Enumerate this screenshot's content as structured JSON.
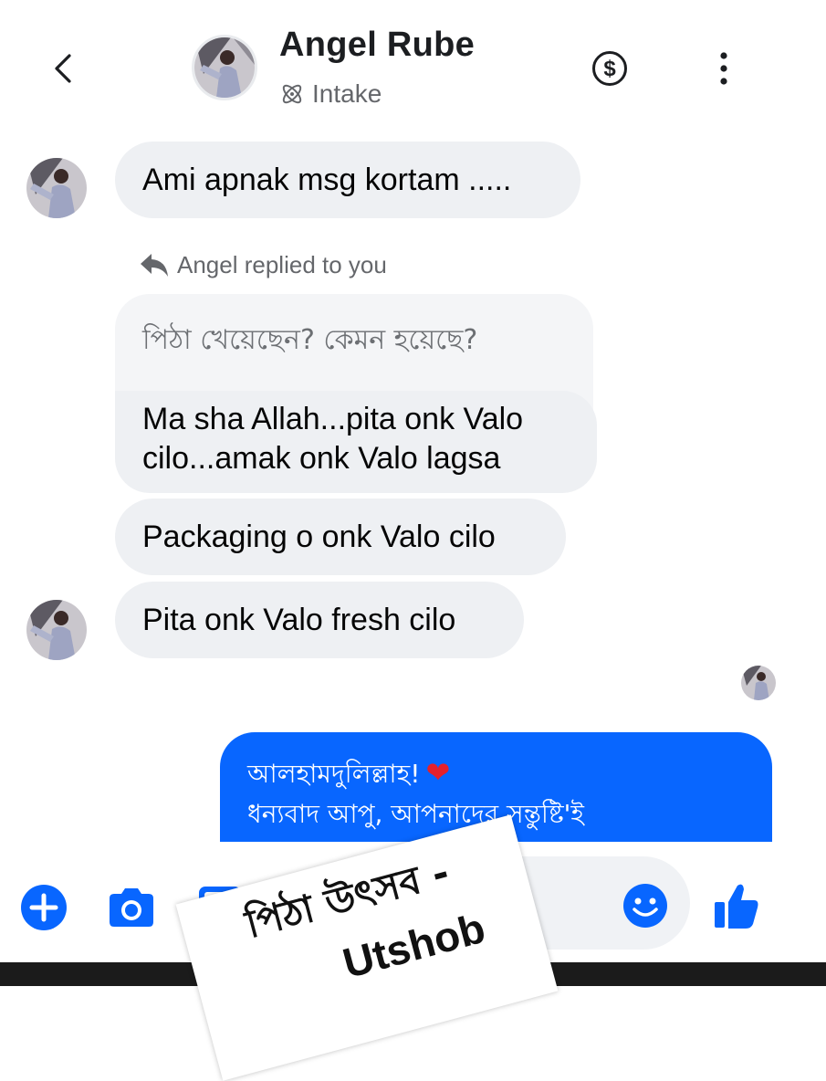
{
  "header": {
    "back_icon": "chevron-left-icon",
    "contact_name": "Angel Rube",
    "subtitle": "Intake",
    "subtitle_icon": "atom-icon",
    "payment_icon": "dollar-circle-icon",
    "menu_icon": "more-vertical-icon"
  },
  "messages": [
    {
      "sender": "Angel Rube",
      "text": "Ami apnak msg kortam ....."
    },
    {
      "reply_label": "Angel replied to you",
      "quoted": "পিঠা খেয়েছেন? কেমন হয়েছে?",
      "text": "Ma sha Allah...pita onk Valo cilo...amak onk Valo lagsa"
    },
    {
      "text": "Packaging o onk Valo cilo"
    },
    {
      "text": "Pita onk Valo fresh cilo"
    }
  ],
  "outgoing": {
    "line1": "আলহামদুলিল্লাহ!",
    "heart": "❤",
    "line2": "ধন্যবাদ আপু, আপনাদের সন্তুষ্টি'ই"
  },
  "composer": {
    "icons": [
      "plus-icon",
      "camera-icon",
      "image-icon",
      "microphone-icon",
      "emoji-icon",
      "thumbs-up-icon"
    ]
  },
  "overlay": {
    "line1": "পিঠা উৎসব -",
    "line2": "Utshob"
  },
  "colors": {
    "accent": "#0866ff",
    "incoming_bubble": "#eef0f3",
    "heart": "#e5202b"
  }
}
